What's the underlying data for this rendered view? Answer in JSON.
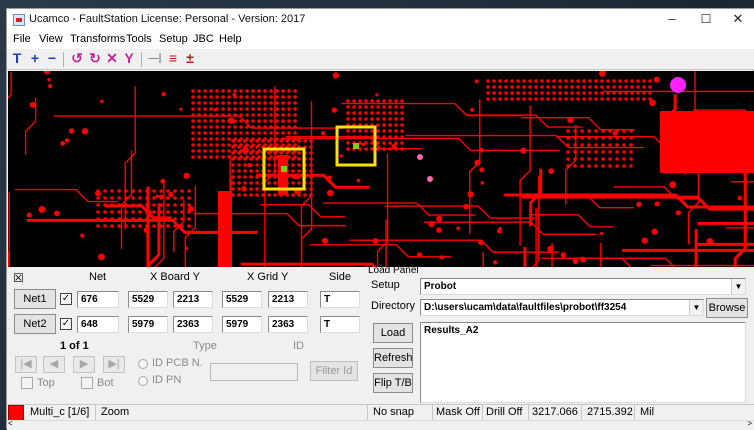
{
  "window": {
    "title": "Ucamco - FaultStation  License: Personal - Version: 2017",
    "minimize_glyph": "–",
    "maximize_glyph": "☐",
    "close_glyph": "✕"
  },
  "menu": [
    "File",
    "View",
    "Transforms",
    "Tools",
    "Setup",
    "JBC",
    "Help"
  ],
  "toolbar": {
    "icons": [
      "T",
      "+",
      "−",
      "↺",
      "↻",
      "✕",
      "Y",
      "—|",
      "≡",
      "±"
    ],
    "icon_names": [
      "text-tool-icon",
      "zoom-in-icon",
      "zoom-out-icon",
      "rotate-left-icon",
      "rotate-right-icon",
      "mirror-x-icon",
      "mirror-y-icon",
      "measure-icon",
      "layers-icon",
      "align-icon"
    ]
  },
  "net_panel": {
    "close_glyph": "☒",
    "headers": {
      "net": "Net",
      "board": "X Board Y",
      "grid": "X Grid Y",
      "side": "Side"
    },
    "rows": [
      {
        "button": "Net1",
        "checked": "✓",
        "net": "676",
        "board_x": "5529",
        "board_y": "2213",
        "grid_x": "5529",
        "grid_y": "2213",
        "side": "T"
      },
      {
        "button": "Net2",
        "checked": "✓",
        "net": "648",
        "board_x": "5979",
        "board_y": "2363",
        "grid_x": "5979",
        "grid_y": "2363",
        "side": "T"
      }
    ],
    "pager": "1 of 1",
    "type_label": "Type",
    "id_label": "ID",
    "nav_first": "|◀",
    "nav_prev": "◀",
    "nav_next": "▶",
    "nav_last": "▶|",
    "radio_pcb": "ID PCB N.",
    "radio_pn": "ID PN",
    "top_label": "Top",
    "bot_label": "Bot",
    "filter_button": "Filter Id"
  },
  "load_panel": {
    "group_title": "Load Panel",
    "setup_label": "Setup",
    "setup_value": "Probot",
    "directory_label": "Directory",
    "directory_value": "D:\\users\\ucam\\data\\faultfiles\\probot\\ff3254",
    "browse_button": "Browse",
    "load_button": "Load",
    "refresh_button": "Refresh",
    "flip_button": "Flip T/B",
    "results": [
      "Results_A2"
    ],
    "combo_arrow": "▼"
  },
  "statusbar": {
    "color_swatch": "#ff0000",
    "layer": "Multi_c [1/6]",
    "mode": "Zoom",
    "snap": "No snap",
    "mask": "Mask Off",
    "drill": "Drill Off",
    "x": "3217.066",
    "y": "2715.392",
    "units": "Mil"
  },
  "hscroll": {
    "left": "<",
    "right": ">"
  },
  "colors": {
    "copper": "#ff0000",
    "highlight": "#ffe000",
    "pad_selected": "#7ad000",
    "pcb_background": "#000000"
  }
}
